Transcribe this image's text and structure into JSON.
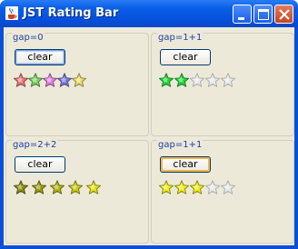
{
  "window": {
    "title": "JST Rating Bar",
    "controls": [
      "minimize",
      "maximize",
      "close"
    ]
  },
  "panels": [
    {
      "title": "gap=0",
      "button_label": "clear",
      "button_state": "focused",
      "rating": 5,
      "max": 5,
      "star_colors": [
        "#e87878",
        "#7ad06a",
        "#e080e0",
        "#7878e0",
        "#e8e06a"
      ],
      "empty_color": "#e8e8e8"
    },
    {
      "title": "gap=1+1",
      "button_label": "clear",
      "button_state": "normal",
      "rating": 2,
      "max": 5,
      "star_colors": [
        "#22d63a",
        "#22d63a",
        "#e8e8e8",
        "#e8e8e8",
        "#e8e8e8"
      ],
      "empty_color": "#e8e8e8"
    },
    {
      "title": "gap=2+2",
      "button_label": "clear",
      "button_state": "normal",
      "rating": 5,
      "max": 5,
      "star_colors": [
        "#8a8a10",
        "#9a9a10",
        "#b0b010",
        "#c8c810",
        "#e0e010"
      ],
      "empty_color": "#e8e8e8"
    },
    {
      "title": "gap=1+1",
      "button_label": "clear",
      "button_state": "hover",
      "rating": 3,
      "max": 5,
      "star_colors": [
        "#f0ec1a",
        "#f0ec1a",
        "#f0ec1a",
        "#e8e8e8",
        "#e8e8e8"
      ],
      "empty_color": "#e8e8e8"
    }
  ]
}
